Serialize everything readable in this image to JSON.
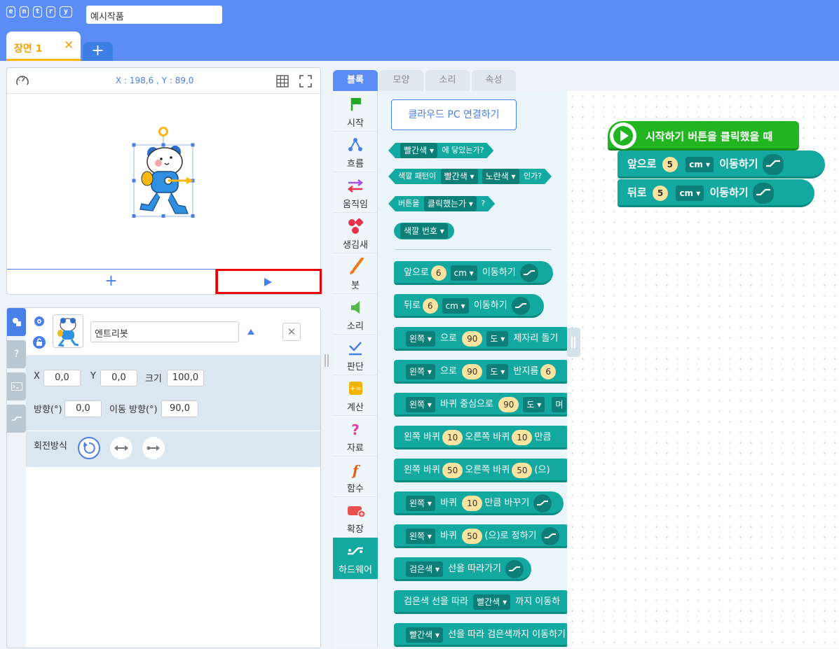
{
  "header": {
    "logo_letters": [
      "e",
      "n",
      "t",
      "r",
      "y"
    ],
    "project_title": "예시작품",
    "scene_tab": "장면 1",
    "scene_close": "✕",
    "scene_add": "+"
  },
  "stage": {
    "coords": "X : 198,6 , Y : 89,0",
    "add_button": "+"
  },
  "object": {
    "name": "엔트리봇",
    "x_label": "X",
    "x_value": "0,0",
    "y_label": "Y",
    "y_value": "0,0",
    "size_label": "크기",
    "size_value": "100,0",
    "dir_label": "방향(°)",
    "dir_value": "0,0",
    "move_dir_label": "이동 방향(°)",
    "move_dir_value": "90,0",
    "rotation_label": "회전방식"
  },
  "tabs": [
    "블록",
    "모양",
    "소리",
    "속성"
  ],
  "categories": [
    {
      "label": "시작",
      "icon": "flag-icon",
      "color": "#22aa22"
    },
    {
      "label": "흐름",
      "icon": "flow-icon",
      "color": "#4a7ee8"
    },
    {
      "label": "움직임",
      "icon": "move-icon",
      "color": "#a94ee0"
    },
    {
      "label": "생김새",
      "icon": "looks-icon",
      "color": "#e8324a"
    },
    {
      "label": "붓",
      "icon": "brush-icon",
      "color": "#f07a1a"
    },
    {
      "label": "소리",
      "icon": "sound-icon",
      "color": "#55b94a"
    },
    {
      "label": "판단",
      "icon": "judge-icon",
      "color": "#4a7ee8"
    },
    {
      "label": "계산",
      "icon": "calc-icon",
      "color": "#f0b400"
    },
    {
      "label": "자료",
      "icon": "data-icon",
      "color": "#e040a0"
    },
    {
      "label": "함수",
      "icon": "function-icon",
      "color": "#e0601a"
    },
    {
      "label": "확장",
      "icon": "extension-icon",
      "color": "#e85050"
    },
    {
      "label": "하드웨어",
      "icon": "hardware-icon",
      "color": "#13a9a0"
    }
  ],
  "palette": {
    "cloud_button": "클라우드 PC 연결하기",
    "b1": {
      "dd": "빨간색",
      "text": "에 닿았는가?"
    },
    "b2": {
      "t1": "색깔 패턴이",
      "dd1": "빨간색",
      "dd2": "노란색",
      "t2": "인가?"
    },
    "b3": {
      "t1": "버튼을",
      "dd": "클릭했는가",
      "t2": "?"
    },
    "b4": {
      "dd": "색깔 번호"
    },
    "b5": {
      "t1": "앞으로",
      "n": "6",
      "dd": "cm",
      "t2": "이동하기"
    },
    "b6": {
      "t1": "뒤로",
      "n": "6",
      "dd": "cm",
      "t2": "이동하기"
    },
    "b7": {
      "dd": "왼쪽",
      "t1": "으로",
      "n": "90",
      "dd2": "도",
      "t2": "제자리 돌기"
    },
    "b8": {
      "dd": "왼쪽",
      "t1": "으로",
      "n": "90",
      "dd2": "도",
      "t2": "반지름",
      "n2": "6"
    },
    "b9": {
      "dd": "왼쪽",
      "t1": "바퀴 중심으로",
      "n": "90",
      "dd2": "도",
      "t2": "며"
    },
    "b10": {
      "t1": "왼쪽 바퀴",
      "n": "10",
      "t2": "오른쪽 바퀴",
      "n2": "10",
      "t3": "만큼"
    },
    "b11": {
      "t1": "왼쪽 바퀴",
      "n": "50",
      "t2": "오른쪽 바퀴",
      "n2": "50",
      "t3": "(으)"
    },
    "b12": {
      "dd": "왼쪽",
      "t1": "바퀴",
      "n": "10",
      "t2": "만큼 바꾸기"
    },
    "b13": {
      "dd": "왼쪽",
      "t1": "바퀴",
      "n": "50",
      "t2": "(으)로 정하기"
    },
    "b14": {
      "dd": "검은색",
      "t1": "선을 따라가기"
    },
    "b15": {
      "t1": "검은색 선을 따라",
      "dd": "빨간색",
      "t2": "까지 이동하"
    },
    "b16": {
      "dd": "빨간색",
      "t1": "선을 따라 검은색까지 이동하기"
    }
  },
  "script": {
    "hat": "시작하기 버튼을 클릭했을 때",
    "s1": {
      "t1": "앞으로",
      "n": "5",
      "dd": "cm",
      "t2": "이동하기"
    },
    "s2": {
      "t1": "뒤로",
      "n": "5",
      "dd": "cm",
      "t2": "이동하기"
    }
  }
}
